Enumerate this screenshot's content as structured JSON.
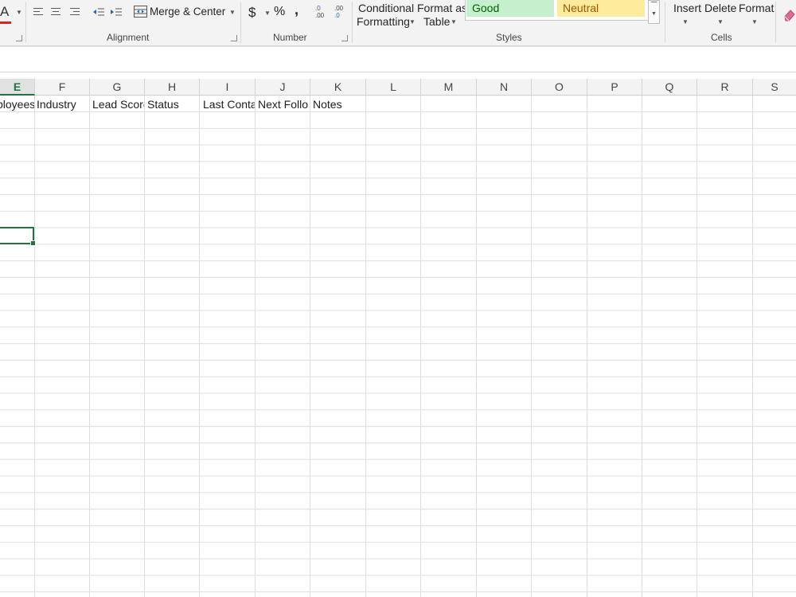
{
  "ribbon": {
    "merge_center_label": "Merge & Center",
    "currency_symbol": "$",
    "percent_symbol": "%",
    "comma_symbol": ",",
    "increase_decimal_top": ".0",
    "increase_decimal_bottom": ".00",
    "decrease_decimal_top": ".00",
    "decrease_decimal_bottom": ".0",
    "conditional_formatting_line1": "Conditional",
    "conditional_formatting_line2": "Formatting",
    "format_as_table_line1": "Format as",
    "format_as_table_line2": "Table",
    "style_good": "Good",
    "style_neutral": "Neutral",
    "insert_label": "Insert",
    "delete_label": "Delete",
    "format_label": "Format",
    "groups": {
      "alignment": "Alignment",
      "number": "Number",
      "styles": "Styles",
      "cells": "Cells"
    },
    "colors": {
      "font_color_bar": "#e02020",
      "good_bg": "#c6efce",
      "good_text": "#006100",
      "neutral_bg": "#ffeb9c",
      "neutral_text": "#9c5700",
      "accent": "#217346"
    }
  },
  "sheet": {
    "columns": [
      "E",
      "F",
      "G",
      "H",
      "I",
      "J",
      "K",
      "L",
      "M",
      "N",
      "O",
      "P",
      "Q",
      "R",
      "S"
    ],
    "active_column": "E",
    "header_row": [
      "ployees",
      "Industry",
      "Lead Score",
      "Status",
      "Last Conta",
      "Next Follo",
      "Notes"
    ]
  }
}
